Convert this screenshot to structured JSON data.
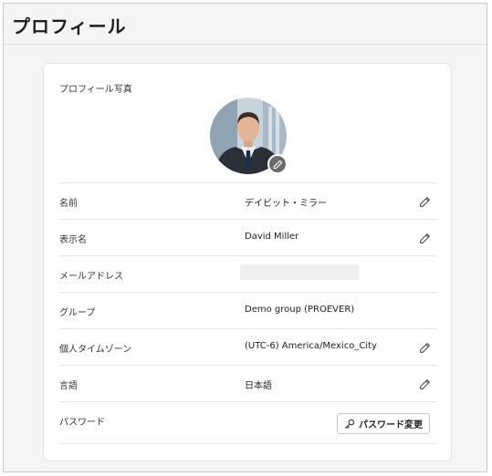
{
  "page": {
    "title": "プロフィール"
  },
  "profile_photo": {
    "label": "プロフィール写真",
    "edit_icon": "pencil-icon"
  },
  "rows": [
    {
      "label": "名前",
      "value": "デイビット・ミラー",
      "editable": true
    },
    {
      "label": "表示名",
      "value": "David Miller",
      "editable": true
    },
    {
      "label": "メールアドレス",
      "value": "",
      "editable": false
    },
    {
      "label": "グループ",
      "value": "Demo group (PROEVER)",
      "editable": false
    },
    {
      "label": "個人タイムゾーン",
      "value": "(UTC-6) America/Mexico_City",
      "editable": true
    },
    {
      "label": "言語",
      "value": "日本語",
      "editable": true
    },
    {
      "label": "パスワード",
      "button_label": "パスワード変更",
      "button_icon": "key-icon"
    }
  ]
}
